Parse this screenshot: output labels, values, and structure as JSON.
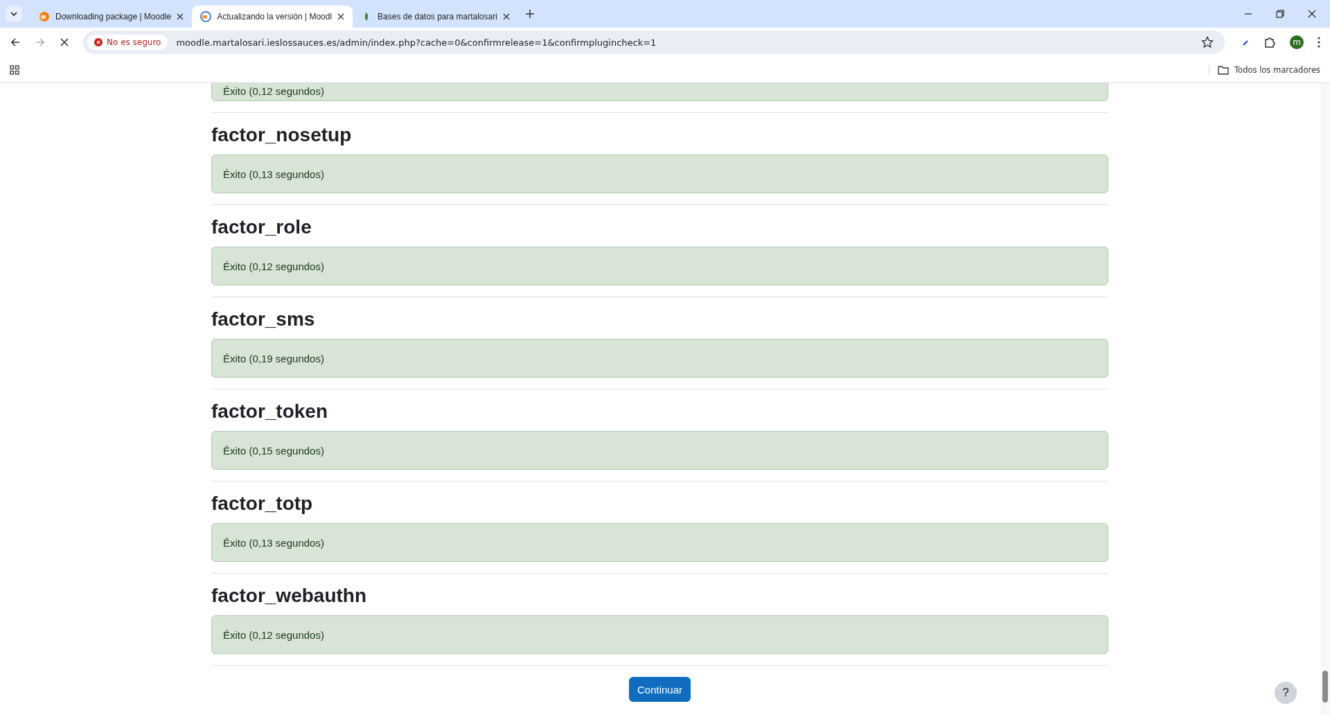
{
  "browser": {
    "tabs": [
      {
        "title": "Downloading package | Moodle",
        "selected": false
      },
      {
        "title": "Actualizando la versión | Moodl",
        "selected": true
      },
      {
        "title": "Bases de datos para martalosari",
        "selected": false
      }
    ],
    "security_label": "No es seguro",
    "url": "moodle.martalosari.ieslossauces.es/admin/index.php?cache=0&confirmrelease=1&confirmplugincheck=1",
    "avatar_letter": "m",
    "bookmarks_label": "Todos los marcadores"
  },
  "partial_result": "Éxito (0,12 segundos)",
  "plugins": [
    {
      "name": "factor_nosetup",
      "result": "Éxito (0,13 segundos)"
    },
    {
      "name": "factor_role",
      "result": "Éxito (0,12 segundos)"
    },
    {
      "name": "factor_sms",
      "result": "Éxito (0,19 segundos)"
    },
    {
      "name": "factor_token",
      "result": "Éxito (0,15 segundos)"
    },
    {
      "name": "factor_totp",
      "result": "Éxito (0,13 segundos)"
    },
    {
      "name": "factor_webauthn",
      "result": "Éxito (0,12 segundos)"
    }
  ],
  "continue_button": "Continuar",
  "help_button": "?"
}
